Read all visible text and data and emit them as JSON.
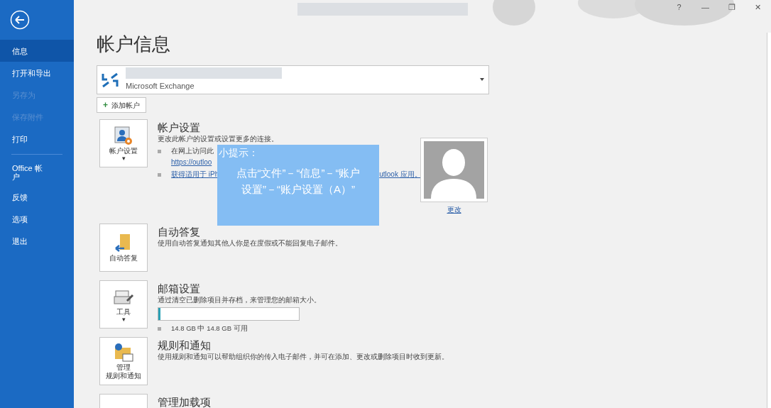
{
  "window": {
    "controls": [
      "?",
      "—",
      "❐",
      "✕"
    ]
  },
  "sidebar": {
    "items": [
      {
        "label": "信息",
        "selected": true,
        "disabled": false
      },
      {
        "label": "打开和导出",
        "selected": false,
        "disabled": false
      },
      {
        "label": "另存为",
        "selected": false,
        "disabled": true
      },
      {
        "label": "保存附件",
        "selected": false,
        "disabled": true
      },
      {
        "label": "打印",
        "selected": false,
        "disabled": false
      },
      {
        "label": "Office 帐户",
        "selected": false,
        "disabled": false,
        "divider_before": true
      },
      {
        "label": "反馈",
        "selected": false,
        "disabled": false
      },
      {
        "label": "选项",
        "selected": false,
        "disabled": false
      },
      {
        "label": "退出",
        "selected": false,
        "disabled": false
      }
    ]
  },
  "page_title": "帐户信息",
  "account": {
    "type": "Microsoft Exchange"
  },
  "add_account": {
    "icon": "+",
    "label": "添加帐户"
  },
  "sections": [
    {
      "kind": "account",
      "tile": [
        "帐户设置"
      ],
      "tile_caret": "▾",
      "title": "帐户设置",
      "description": "更改此帐户的设置或设置更多的连接。",
      "bullets": [
        {
          "parts": [
            "在网上访问此"
          ],
          "link": "https://outloo"
        },
        {
          "link_parts": [
            "获得适用于 iPh",
            "utlook 应用。"
          ]
        }
      ]
    },
    {
      "kind": "autoreply",
      "tile": [
        "自动答复"
      ],
      "title": "自动答复",
      "description": "使用自动答复通知其他人你是在度假或不能回复电子邮件。"
    },
    {
      "kind": "mailbox",
      "tile": [
        "工具"
      ],
      "tile_caret": "▾",
      "title": "邮箱设置",
      "description": "通过清空已删除项目并存档，来管理您的邮箱大小。",
      "storage": {
        "level": 0.01,
        "reading": "14.8 GB 中 14.8 GB 可用"
      }
    },
    {
      "kind": "rules",
      "tile": [
        "管理",
        "规则和通知"
      ],
      "title": "规则和通知",
      "description": "使用规则和通知可以帮助组织你的传入电子邮件，并可在添加、更改或删除项目时收到更新。"
    },
    {
      "kind": "addins",
      "title": "管理加载项"
    }
  ],
  "profile": {
    "change_link": "更改"
  },
  "hint": {
    "title": "小提示：",
    "body": "点击“文件”－“信息”－“账户设置”－“账户设置（A）”"
  }
}
